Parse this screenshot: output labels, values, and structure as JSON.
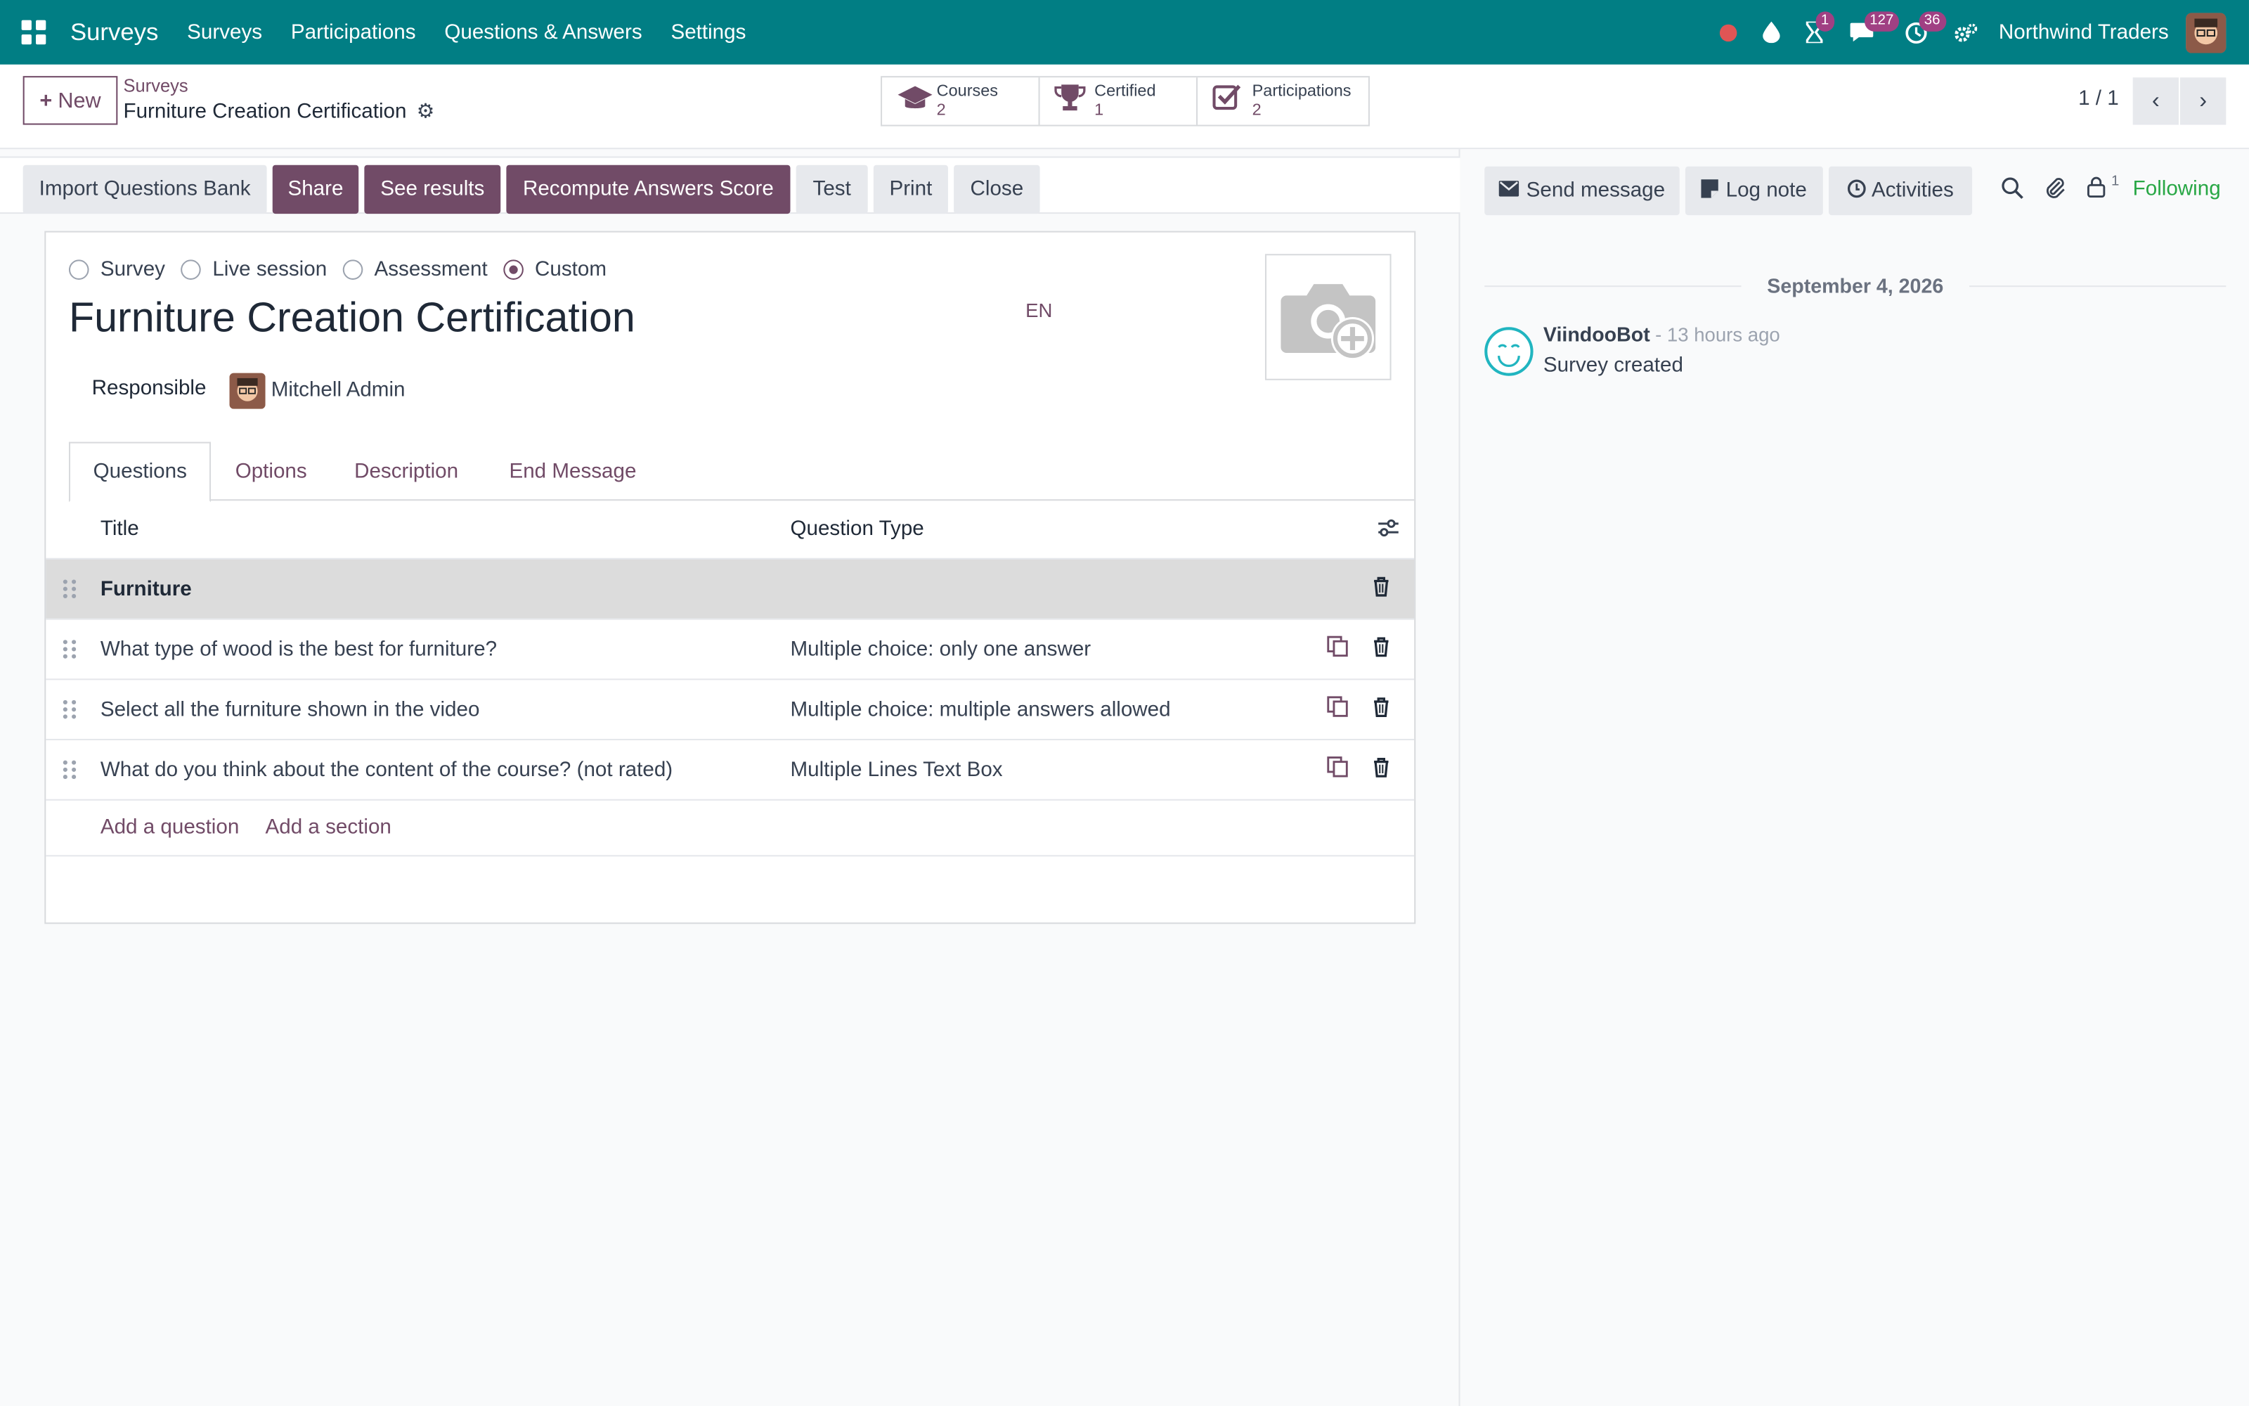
{
  "navbar": {
    "brand": "Surveys",
    "menu": [
      "Surveys",
      "Participations",
      "Questions & Answers",
      "Settings"
    ],
    "badges": {
      "activities": "1",
      "messages": "127",
      "clock": "36"
    },
    "company": "Northwind Traders",
    "color": "#017e84"
  },
  "control_panel": {
    "new_label": "New",
    "breadcrumb_parent": "Surveys",
    "breadcrumb_current": "Furniture Creation Certification",
    "stats": [
      {
        "label": "Courses",
        "value": "2",
        "icon": "graduation-cap-icon"
      },
      {
        "label": "Certified",
        "value": "1",
        "icon": "trophy-icon"
      },
      {
        "label": "Participations",
        "value": "2",
        "icon": "checkbox-icon"
      }
    ],
    "pager": "1 / 1"
  },
  "statusbar": {
    "buttons": [
      "Import Questions Bank",
      "Share",
      "See results",
      "Recompute Answers Score",
      "Test",
      "Print",
      "Close"
    ]
  },
  "form": {
    "survey_types": [
      "Survey",
      "Live session",
      "Assessment",
      "Custom"
    ],
    "selected_type": "Custom",
    "title": "Furniture Creation Certification",
    "lang": "EN",
    "responsible_label": "Responsible",
    "responsible_name": "Mitchell Admin",
    "tabs": [
      "Questions",
      "Options",
      "Description",
      "End Message"
    ],
    "active_tab": "Questions",
    "table": {
      "headers": [
        "Title",
        "Question Type"
      ],
      "rows": [
        {
          "title": "Furniture",
          "type": "",
          "section": true
        },
        {
          "title": "What type of wood is the best for furniture?",
          "type": "Multiple choice: only one answer",
          "section": false
        },
        {
          "title": "Select all the furniture shown in the video",
          "type": "Multiple choice: multiple answers allowed",
          "section": false
        },
        {
          "title": "What do you think about the content of the course? (not rated)",
          "type": "Multiple Lines Text Box",
          "section": false
        }
      ],
      "add_question": "Add a question",
      "add_section": "Add a section"
    }
  },
  "chatter": {
    "send_message": "Send message",
    "log_note": "Log note",
    "activities": "Activities",
    "follower_count": "1",
    "following": "Following",
    "date": "September 4, 2026",
    "message": {
      "author": "ViindooBot",
      "time": "- 13 hours ago",
      "body": "Survey created"
    }
  },
  "colors": {
    "accent": "#714b67",
    "navbar": "#017e84",
    "following": "#28a745"
  }
}
